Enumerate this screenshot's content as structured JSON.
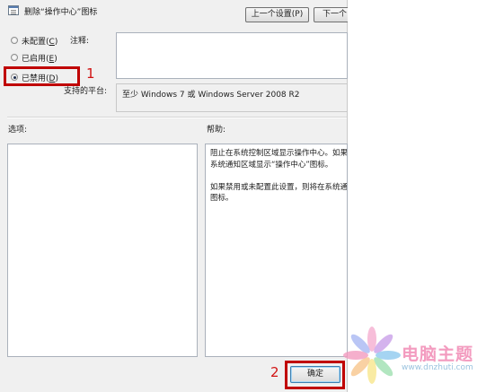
{
  "dialog": {
    "title": "删除“操作中心”图标",
    "prev_button": "上一个设置(P)",
    "next_button": "下一个"
  },
  "state": {
    "options": [
      {
        "label_pre": "未配置(",
        "key": "C",
        "label_post": ")",
        "checked": false
      },
      {
        "label_pre": "已启用(",
        "key": "E",
        "label_post": ")",
        "checked": false
      },
      {
        "label_pre": "已禁用(",
        "key": "D",
        "label_post": ")",
        "checked": true
      }
    ]
  },
  "comment": {
    "label": "注释:",
    "value": ""
  },
  "platform": {
    "label": "支持的平台:",
    "value": "至少 Windows 7 或 Windows Server 2008 R2"
  },
  "options_section": {
    "label": "选项:"
  },
  "help_section": {
    "label": "帮助:",
    "text": "阻止在系统控制区域显示操作中心。如果\n系统通知区域显示“操作中心”图标。\n\n如果禁用或未配置此设置，则将在系统通\n图标。"
  },
  "footer": {
    "ok_button": "确定"
  },
  "annotations": {
    "marker_1": "1",
    "marker_2": "2",
    "color": "#c00000"
  },
  "watermark": {
    "title": "电脑主题",
    "url": "www.dnzhuti.com"
  }
}
